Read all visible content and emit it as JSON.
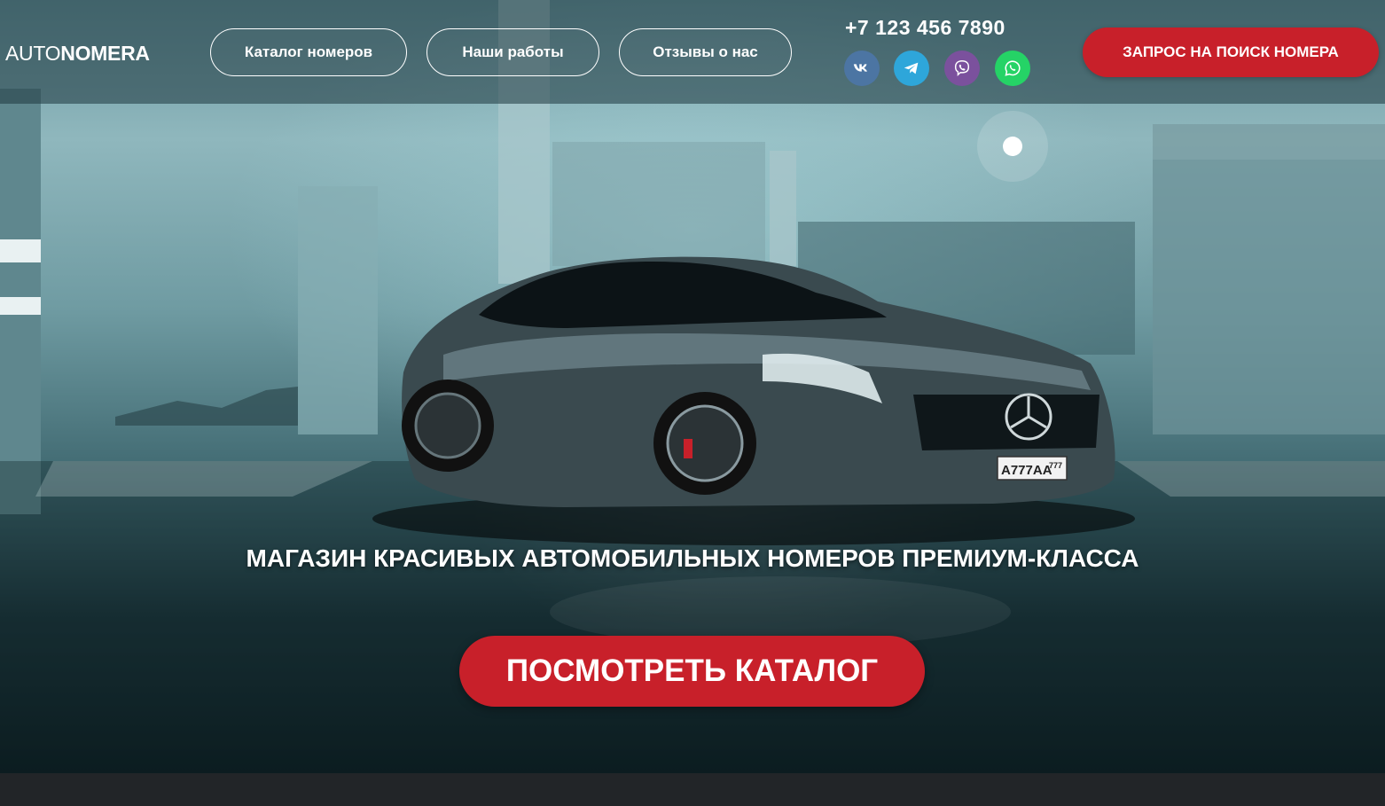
{
  "header": {
    "logo": {
      "part1": "AUTO",
      "part2": "NOMERA"
    },
    "nav": [
      {
        "label": "Каталог номеров"
      },
      {
        "label": "Наши работы"
      },
      {
        "label": "Отзывы о нас"
      }
    ],
    "phone": "+7 123 456 7890",
    "social": [
      {
        "icon": "vk-icon",
        "color": "#4c75a3"
      },
      {
        "icon": "telegram-icon",
        "color": "#2ea6da"
      },
      {
        "icon": "viber-icon",
        "color": "#7b519d"
      },
      {
        "icon": "whatsapp-icon",
        "color": "#25d366"
      }
    ],
    "search_request_label": "ЗАПРОС НА ПОИСК НОМЕРА"
  },
  "hero": {
    "headline": "МАГАЗИН КРАСИВЫХ АВТОМОБИЛЬНЫХ НОМЕРОВ ПРЕМИУМ-КЛАССА",
    "cta_label": "ПОСМОТРЕТЬ КАТАЛОГ",
    "plate_number": "A777AA",
    "plate_region": "777"
  },
  "colors": {
    "accent_red": "#c8202a",
    "footer": "#222528"
  }
}
